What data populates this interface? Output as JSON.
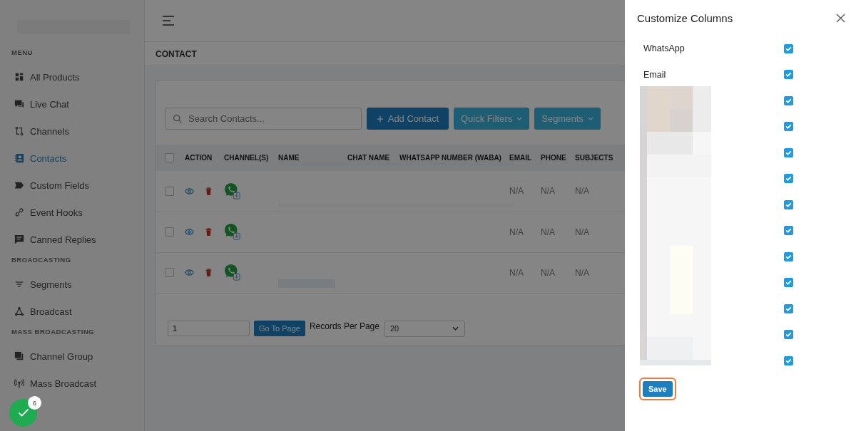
{
  "sidebar": {
    "sections": [
      {
        "title": "MENU",
        "items": [
          {
            "label": "All Products",
            "selected": false
          },
          {
            "label": "Live Chat",
            "selected": false
          },
          {
            "label": "Channels",
            "selected": false
          },
          {
            "label": "Contacts",
            "selected": true
          },
          {
            "label": "Custom Fields",
            "selected": false
          },
          {
            "label": "Event Hooks",
            "selected": false
          },
          {
            "label": "Canned Replies",
            "selected": false
          }
        ]
      },
      {
        "title": "BROADCASTING",
        "items": [
          {
            "label": "Segments",
            "selected": false
          },
          {
            "label": "Broadcast",
            "selected": false
          }
        ]
      },
      {
        "title": "MASS BROADCASTING",
        "items": [
          {
            "label": "Channel Group",
            "selected": false
          },
          {
            "label": "Mass Broadcast",
            "selected": false
          }
        ]
      }
    ]
  },
  "page_title": "CONTACT",
  "toolbar": {
    "search": {
      "placeholder": "Search Contacts..."
    },
    "add_button": "Add Contact",
    "quick_filters": "Quick Filters",
    "segments": "Segments"
  },
  "table": {
    "columns": [
      "ACTION",
      "CHANNEL(S)",
      "NAME",
      "CHAT NAME",
      "WHATSAPP NUMBER (WABA)",
      "EMAIL",
      "PHONE",
      "SUBJECTS"
    ],
    "select_all_checked": false,
    "rows": [
      {
        "checked": false,
        "email": "N/A",
        "phone": "N/A",
        "subjects": "N/A"
      },
      {
        "checked": false,
        "email": "N/A",
        "phone": "N/A",
        "subjects": "N/A"
      },
      {
        "checked": false,
        "email": "N/A",
        "phone": "N/A",
        "subjects": "N/A"
      }
    ]
  },
  "pagination": {
    "page": "1",
    "go_button": "Go To Page",
    "per_page_label": "Records Per Page",
    "per_page": "20"
  },
  "fab": {
    "badge": "6"
  },
  "drawer": {
    "title": "Customize Columns",
    "columns": [
      {
        "label": "WhatsApp",
        "checked": true
      },
      {
        "label": "Email",
        "checked": true
      },
      {
        "checked": true
      },
      {
        "checked": true
      },
      {
        "checked": true
      },
      {
        "checked": true
      },
      {
        "checked": true
      },
      {
        "checked": true
      },
      {
        "checked": true
      },
      {
        "checked": true
      },
      {
        "checked": true
      },
      {
        "checked": true
      },
      {
        "checked": true
      }
    ],
    "save_button": "Save"
  }
}
